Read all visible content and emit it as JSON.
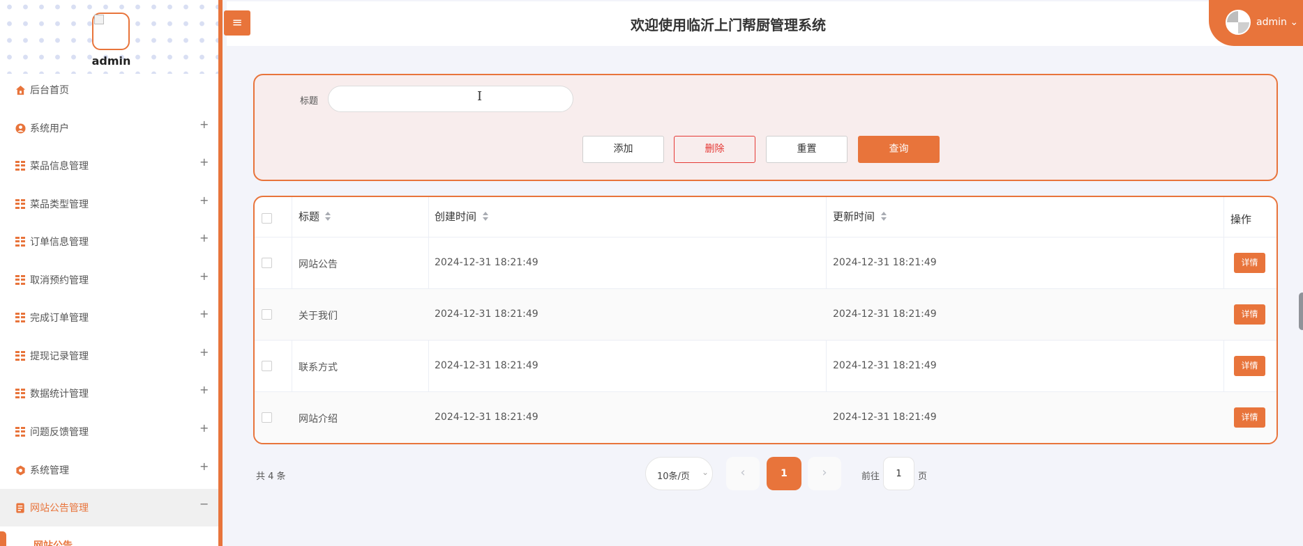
{
  "app": {
    "title": "欢迎使用临沂上门帮厨管理系统",
    "user": "admin",
    "user_menu_label": "admin",
    "accent_color": "#e8743b"
  },
  "sidebar": {
    "username": "admin",
    "items": [
      {
        "label": "后台首页",
        "icon": "home-icon",
        "expandable": false
      },
      {
        "label": "系统用户",
        "icon": "user-icon",
        "expandable": true
      },
      {
        "label": "菜品信息管理",
        "icon": "grid-icon",
        "expandable": true
      },
      {
        "label": "菜品类型管理",
        "icon": "grid-icon",
        "expandable": true
      },
      {
        "label": "订单信息管理",
        "icon": "grid-icon",
        "expandable": true
      },
      {
        "label": "取消预约管理",
        "icon": "grid-icon",
        "expandable": true
      },
      {
        "label": "完成订单管理",
        "icon": "grid-icon",
        "expandable": true
      },
      {
        "label": "提现记录管理",
        "icon": "grid-icon",
        "expandable": true
      },
      {
        "label": "数据统计管理",
        "icon": "grid-icon",
        "expandable": true
      },
      {
        "label": "问题反馈管理",
        "icon": "grid-icon",
        "expandable": true
      },
      {
        "label": "系统管理",
        "icon": "gear-icon",
        "expandable": true
      },
      {
        "label": "网站公告管理",
        "icon": "document-icon",
        "expandable": true,
        "expanded": true
      }
    ],
    "plus": "+",
    "minus": "−",
    "active_sub_item": "网站公告"
  },
  "search": {
    "title_label": "标题",
    "title_value": "",
    "buttons": {
      "add": "添加",
      "delete": "删除",
      "reset": "重置",
      "query": "查询"
    }
  },
  "table": {
    "columns": {
      "title": "标题",
      "created": "创建时间",
      "updated": "更新时间",
      "actions": "操作"
    },
    "rows": [
      {
        "title": "网站公告",
        "created": "2024-12-31 18:21:49",
        "updated": "2024-12-31 18:21:49",
        "action": "详情"
      },
      {
        "title": "关于我们",
        "created": "2024-12-31 18:21:49",
        "updated": "2024-12-31 18:21:49",
        "action": "详情"
      },
      {
        "title": "联系方式",
        "created": "2024-12-31 18:21:49",
        "updated": "2024-12-31 18:21:49",
        "action": "详情"
      },
      {
        "title": "网站介绍",
        "created": "2024-12-31 18:21:49",
        "updated": "2024-12-31 18:21:49",
        "action": "详情"
      }
    ]
  },
  "pagination": {
    "total_text": "共 4 条",
    "page_size": "10条/页",
    "prev": "‹",
    "next": "›",
    "current_page": "1",
    "goto_prefix": "前往",
    "goto_value": "1",
    "goto_suffix": "页"
  }
}
